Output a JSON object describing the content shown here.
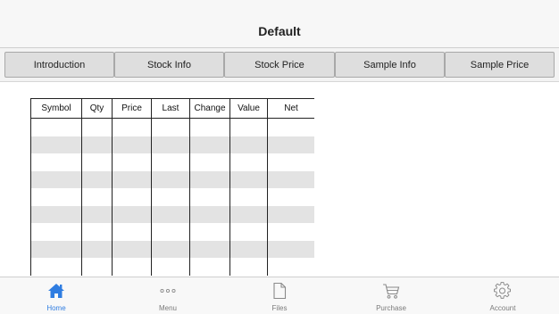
{
  "header": {
    "title": "Default"
  },
  "tabs": [
    {
      "label": "Introduction"
    },
    {
      "label": "Stock Info"
    },
    {
      "label": "Stock Price"
    },
    {
      "label": "Sample Info"
    },
    {
      "label": "Sample Price"
    }
  ],
  "grid": {
    "columns": [
      "Symbol",
      "Qty",
      "Price",
      "Last",
      "Change",
      "Value",
      "Net"
    ],
    "rows": [
      [
        "",
        "",
        "",
        "",
        "",
        "",
        ""
      ],
      [
        "",
        "",
        "",
        "",
        "",
        "",
        ""
      ],
      [
        "",
        "",
        "",
        "",
        "",
        "",
        ""
      ],
      [
        "",
        "",
        "",
        "",
        "",
        "",
        ""
      ],
      [
        "",
        "",
        "",
        "",
        "",
        "",
        ""
      ],
      [
        "",
        "",
        "",
        "",
        "",
        "",
        ""
      ],
      [
        "",
        "",
        "",
        "",
        "",
        "",
        ""
      ],
      [
        "",
        "",
        "",
        "",
        "",
        "",
        ""
      ],
      [
        "",
        "",
        "",
        "",
        "",
        "",
        ""
      ]
    ]
  },
  "bottom_nav": {
    "active": "Home",
    "accent_color": "#2f7de1",
    "items": [
      {
        "label": "Home",
        "icon": "home-icon"
      },
      {
        "label": "Menu",
        "icon": "more-dots-icon"
      },
      {
        "label": "Files",
        "icon": "file-icon"
      },
      {
        "label": "Purchase",
        "icon": "cart-icon"
      },
      {
        "label": "Account",
        "icon": "gear-icon"
      }
    ]
  }
}
